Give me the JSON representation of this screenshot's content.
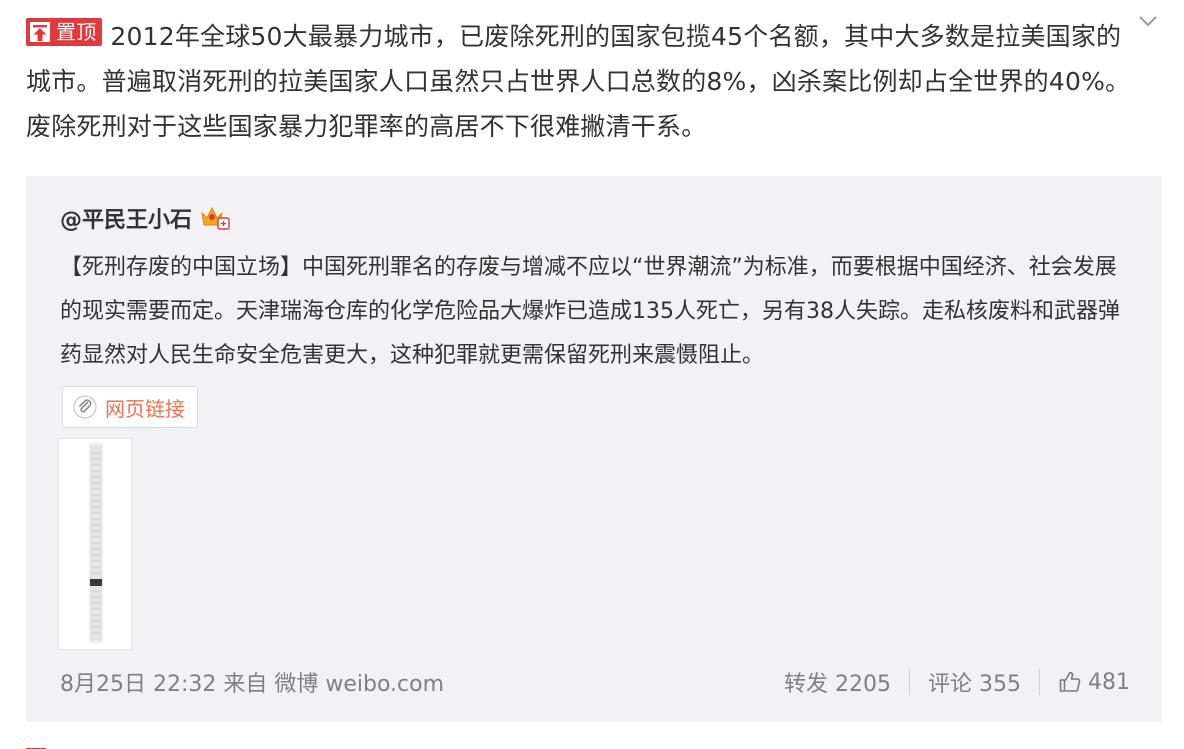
{
  "post": {
    "pin_badge": "置顶",
    "text": "2012年全球50大最暴力城市，已废除死刑的国家包揽45个名额，其中大多数是拉美国家的城市。普遍取消死刑的拉美国家人口虽然只占世界人口总数的8%，凶杀案比例却占全世界的40%。废除死刑对于这些国家暴力犯罪率的高居不下很难撇清干系。"
  },
  "repost": {
    "author": "@平民王小石",
    "text": "【死刑存废的中国立场】中国死刑罪名的存废与增减不应以“世界潮流”为标准，而要根据中国经济、社会发展的现实需要而定。天津瑞海仓库的化学危险品大爆炸已造成135人死亡，另有38人失踪。走私核废料和武器弹药显然对人民生命安全危害更大，这种犯罪就更需保留死刑来震慑阻止。",
    "link_label": "网页链接",
    "footer": {
      "time_source": "8月25日 22:32 来自 微博 weibo.com",
      "repost_count": "转发 2205",
      "comment_count": "评论 355",
      "like_count": "481"
    }
  },
  "colors": {
    "pin_red": "#e0393e",
    "link_orange": "#eb7350",
    "repost_bg": "#f2f2f5",
    "meta_gray": "#808080"
  },
  "icons": {
    "menu": "chevron-down-icon",
    "pin": "pin-top-icon",
    "vip": "vip-crown-icon",
    "link": "paperclip-icon",
    "like": "thumbs-up-icon"
  }
}
